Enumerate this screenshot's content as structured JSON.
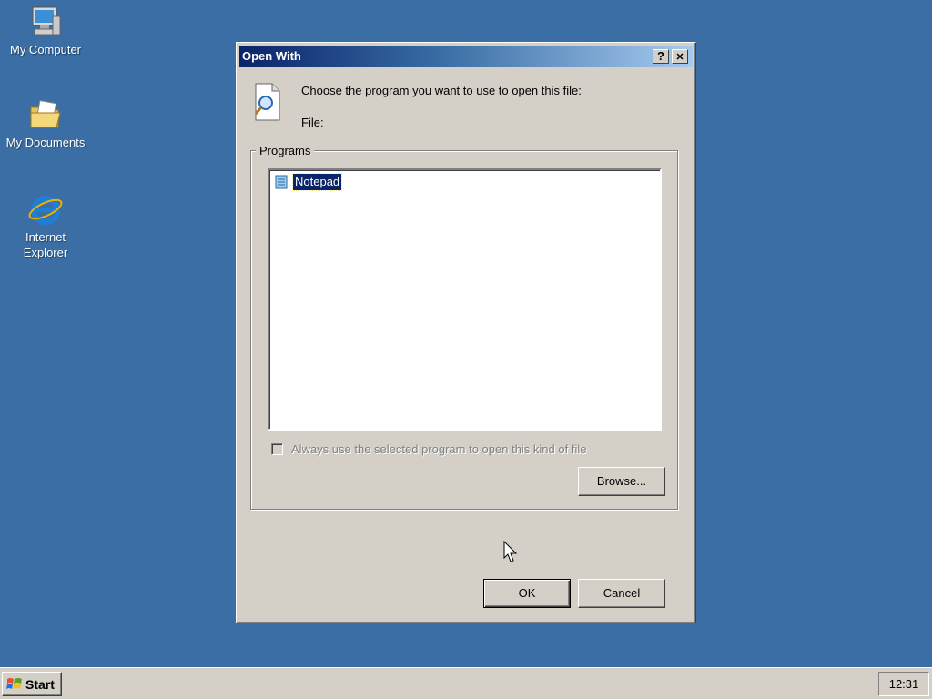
{
  "desktop": {
    "icons": [
      {
        "label": "My Computer",
        "icon": "my-computer-icon"
      },
      {
        "label": "My Documents",
        "icon": "my-documents-icon"
      },
      {
        "label": "Internet Explorer",
        "icon": "internet-explorer-icon"
      }
    ]
  },
  "dialog": {
    "title": "Open With",
    "help_button": "?",
    "close_button": "✕",
    "prompt": "Choose the program you want to use to open this file:",
    "file_label": "File:",
    "programs_group_label": "Programs",
    "programs": [
      {
        "name": "Notepad",
        "selected": true,
        "icon": "notepad-icon"
      }
    ],
    "always_use_label": "Always use the selected program to open this kind of file",
    "always_use_checked": false,
    "always_use_enabled": false,
    "browse_label": "Browse...",
    "ok_label": "OK",
    "cancel_label": "Cancel"
  },
  "taskbar": {
    "start_label": "Start",
    "clock": "12:31"
  },
  "colors": {
    "desktop": "#3a6ea5",
    "title_active_start": "#0a246a",
    "title_active_end": "#a6caf0",
    "selection": "#0a246a"
  }
}
